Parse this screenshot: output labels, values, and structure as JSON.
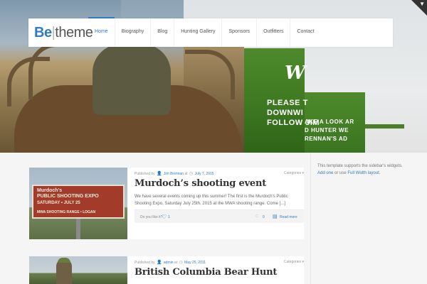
{
  "logo": {
    "be": "Be",
    "bar": "|",
    "theme": "theme"
  },
  "nav": {
    "items": [
      {
        "label": "Home",
        "active": true
      },
      {
        "label": "Biography"
      },
      {
        "label": "Blog"
      },
      {
        "label": "Hunting Gallery"
      },
      {
        "label": "Sponsors"
      },
      {
        "label": "Outfitters"
      },
      {
        "label": "Contact"
      }
    ]
  },
  "hero": {
    "sign_script": "W",
    "sign_lines": [
      "PLEASE T",
      "DOWNWI",
      "FOLLOW JIM"
    ],
    "sign_right_lines": [
      "AKE A LOOK AR",
      "D HUNTER WE",
      "RENNAN'S AD"
    ]
  },
  "posts": [
    {
      "published_by": "Published by",
      "author": "Jim Brennan",
      "at": "at",
      "date": "July 7, 2015",
      "categories": "Categories",
      "title": "Murdoch’s shooting event",
      "excerpt": "We have several events coming up this summer!  The first is the Murdoch’s Public Shooting Expo, Saturday July 25th, 2015 at the MWA shooting range.  Come [...]",
      "likes_label": "Do you like it?",
      "likes": "1",
      "comments": "0",
      "read_more": "Read more",
      "thumb": {
        "line1": "Murdoch’s",
        "line2": "PUBLIC SHOOTING EXPO",
        "line3": "SATURDAY • JULY 25",
        "line4": "MWA SHOOTING RANGE • LOGAN"
      }
    },
    {
      "published_by": "Published by",
      "author": "admin",
      "at": "at",
      "date": "May 25, 2011",
      "categories": "Categories",
      "title": "British Columbia Bear Hunt"
    }
  ],
  "sidebar": {
    "text_before": "This template supports the sidebar's widgets.",
    "link_add": "Add one",
    "text_mid": "or use",
    "link_full_width": "Full Width layout."
  },
  "colors": {
    "accent": "#2f7cc2",
    "content_bg": "#f5f5f5"
  }
}
